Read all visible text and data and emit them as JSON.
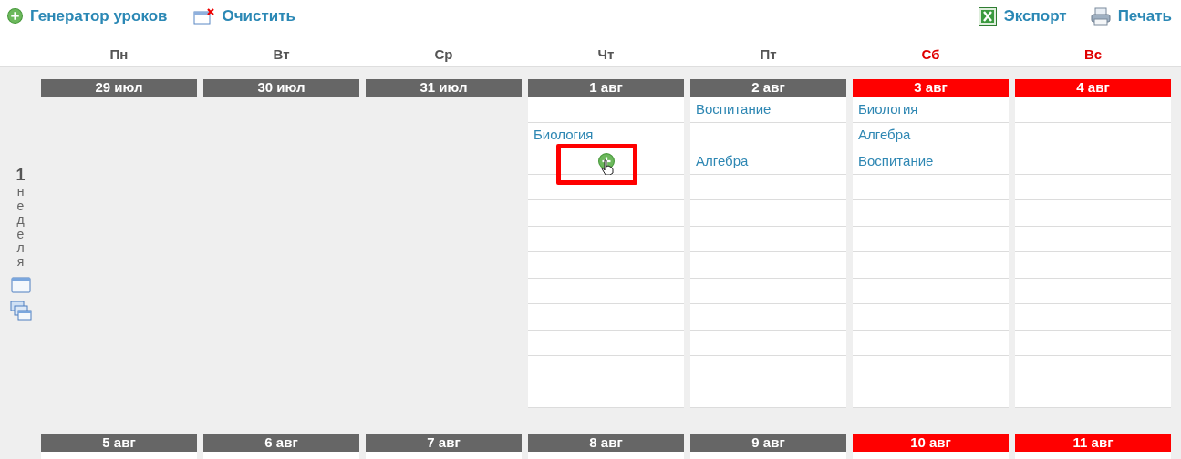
{
  "toolbar": {
    "left": [
      {
        "kind": "generator",
        "label": "Генератор уроков"
      },
      {
        "kind": "clear",
        "label": "Очистить"
      }
    ],
    "right": [
      {
        "kind": "export",
        "label": "Экспорт"
      },
      {
        "kind": "print",
        "label": "Печать"
      }
    ]
  },
  "weekdays": [
    {
      "label": "Пн",
      "weekend": false
    },
    {
      "label": "Вт",
      "weekend": false
    },
    {
      "label": "Ср",
      "weekend": false
    },
    {
      "label": "Чт",
      "weekend": false
    },
    {
      "label": "Пт",
      "weekend": false
    },
    {
      "label": "Сб",
      "weekend": true
    },
    {
      "label": "Вс",
      "weekend": true
    }
  ],
  "weeks": [
    {
      "number": "1",
      "label": "неделя",
      "days": [
        {
          "date": "29 июл",
          "weekend": false
        },
        {
          "date": "30 июл",
          "weekend": false
        },
        {
          "date": "31 июл",
          "weekend": false
        },
        {
          "date": "1 авг",
          "weekend": false,
          "slots": [
            {
              "kind": "empty"
            },
            {
              "kind": "lesson",
              "subject": "Биология"
            },
            {
              "kind": "add",
              "highlighted": true
            },
            {
              "kind": "empty"
            },
            {
              "kind": "empty"
            },
            {
              "kind": "empty"
            },
            {
              "kind": "empty"
            },
            {
              "kind": "empty"
            },
            {
              "kind": "empty"
            },
            {
              "kind": "empty"
            },
            {
              "kind": "empty"
            },
            {
              "kind": "empty"
            }
          ]
        },
        {
          "date": "2 авг",
          "weekend": false,
          "slots": [
            {
              "kind": "lesson",
              "subject": "Воспитание"
            },
            {
              "kind": "empty"
            },
            {
              "kind": "lesson",
              "subject": "Алгебра"
            },
            {
              "kind": "empty"
            },
            {
              "kind": "empty"
            },
            {
              "kind": "empty"
            },
            {
              "kind": "empty"
            },
            {
              "kind": "empty"
            },
            {
              "kind": "empty"
            },
            {
              "kind": "empty"
            },
            {
              "kind": "empty"
            },
            {
              "kind": "empty"
            }
          ]
        },
        {
          "date": "3 авг",
          "weekend": true,
          "slots": [
            {
              "kind": "lesson",
              "subject": "Биология"
            },
            {
              "kind": "lesson",
              "subject": "Алгебра"
            },
            {
              "kind": "lesson",
              "subject": "Воспитание"
            },
            {
              "kind": "empty"
            },
            {
              "kind": "empty"
            },
            {
              "kind": "empty"
            },
            {
              "kind": "empty"
            },
            {
              "kind": "empty"
            },
            {
              "kind": "empty"
            },
            {
              "kind": "empty"
            },
            {
              "kind": "empty"
            },
            {
              "kind": "empty"
            }
          ]
        },
        {
          "date": "4 авг",
          "weekend": true,
          "slots": [
            {
              "kind": "empty"
            },
            {
              "kind": "empty"
            },
            {
              "kind": "empty"
            },
            {
              "kind": "empty"
            },
            {
              "kind": "empty"
            },
            {
              "kind": "empty"
            },
            {
              "kind": "empty"
            },
            {
              "kind": "empty"
            },
            {
              "kind": "empty"
            },
            {
              "kind": "empty"
            },
            {
              "kind": "empty"
            },
            {
              "kind": "empty"
            }
          ]
        }
      ]
    },
    {
      "days": [
        {
          "date": "5 авг",
          "weekend": false,
          "slots": [
            {
              "kind": "empty"
            }
          ]
        },
        {
          "date": "6 авг",
          "weekend": false,
          "slots": [
            {
              "kind": "empty"
            }
          ]
        },
        {
          "date": "7 авг",
          "weekend": false,
          "slots": [
            {
              "kind": "empty"
            }
          ]
        },
        {
          "date": "8 авг",
          "weekend": false,
          "slots": [
            {
              "kind": "empty"
            }
          ]
        },
        {
          "date": "9 авг",
          "weekend": false,
          "slots": [
            {
              "kind": "empty"
            }
          ]
        },
        {
          "date": "10 авг",
          "weekend": true,
          "slots": [
            {
              "kind": "empty"
            }
          ]
        },
        {
          "date": "11 авг",
          "weekend": true,
          "slots": [
            {
              "kind": "empty"
            }
          ]
        }
      ]
    }
  ]
}
